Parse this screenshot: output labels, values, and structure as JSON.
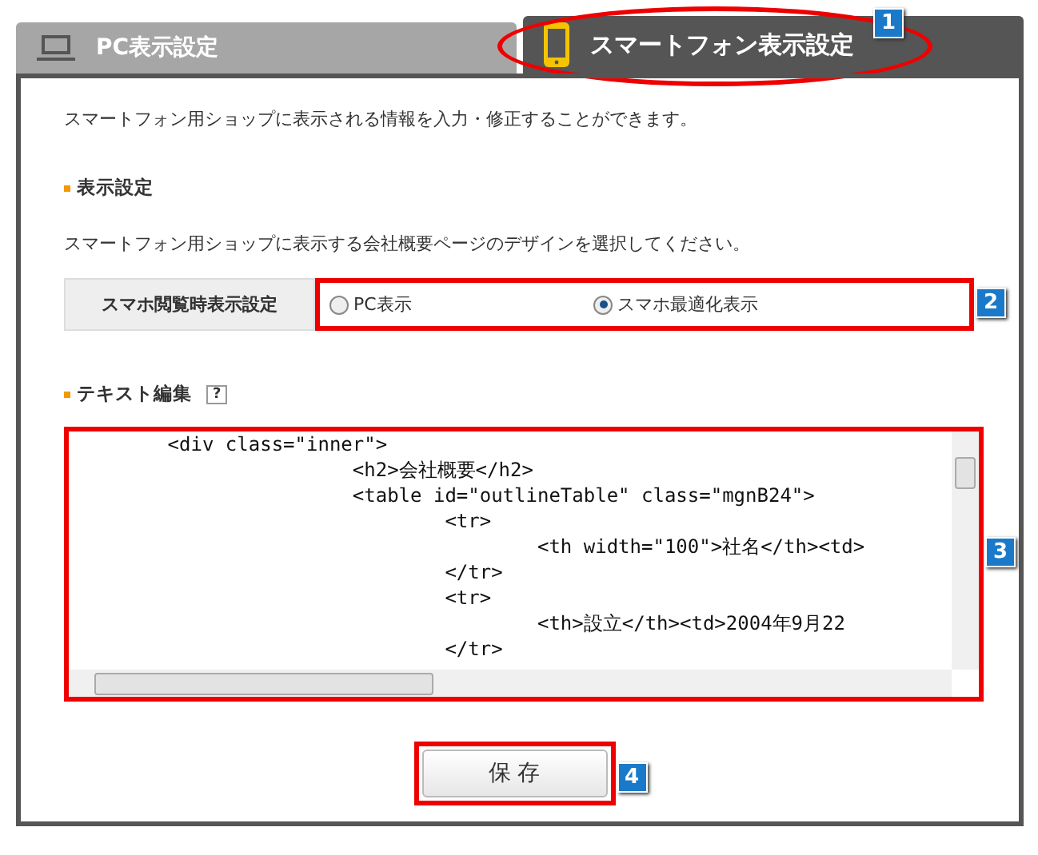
{
  "tabs": [
    {
      "label": "PC表示設定",
      "selected": false
    },
    {
      "label": "スマートフォン表示設定",
      "selected": true
    }
  ],
  "intro": "スマートフォン用ショップに表示される情報を入力・修正することができます。",
  "display_section": {
    "heading": "表示設定",
    "description": "スマートフォン用ショップに表示する会社概要ページのデザインを選択してください。",
    "setting_label": "スマホ閲覧時表示設定",
    "options": [
      {
        "label": "PC表示",
        "selected": false
      },
      {
        "label": "スマホ最適化表示",
        "selected": true
      }
    ]
  },
  "text_section": {
    "heading": "テキスト編集",
    "help": "?",
    "code_lines": [
      "\t<div class=\"inner\">",
      "\t\t\t<h2>会社概要</h2>",
      "\t\t\t<table id=\"outlineTable\" class=\"mgnB24\">",
      "\t\t\t\t<tr>",
      "\t\t\t\t\t<th width=\"100\">社名</th><td>",
      "\t\t\t\t</tr>",
      "\t\t\t\t<tr>",
      "\t\t\t\t\t<th>設立</th><td>2004年9月22",
      "\t\t\t\t</tr>"
    ]
  },
  "save_button": "保 存",
  "annotations": [
    "1",
    "2",
    "3",
    "4"
  ]
}
